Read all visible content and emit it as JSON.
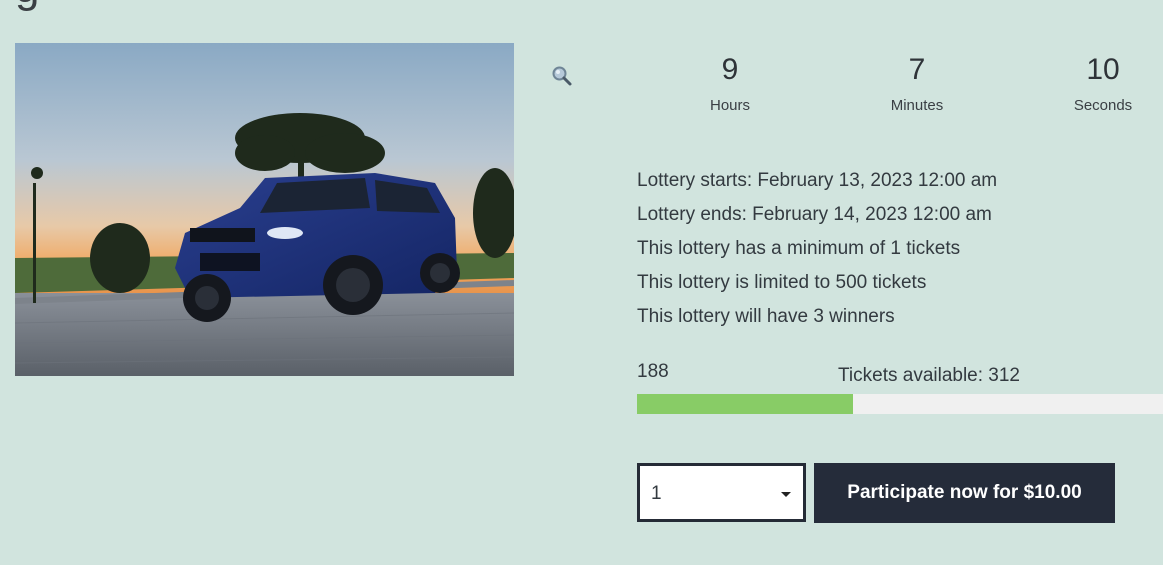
{
  "product": {
    "title_fragment": "g",
    "image": {
      "subject": "blue SUV parked on cobblestone at sunset",
      "icon": "product-photo"
    },
    "zoom_icon": "magnifier-icon"
  },
  "countdown": {
    "hours": {
      "value": "9",
      "label": "Hours"
    },
    "minutes": {
      "value": "7",
      "label": "Minutes"
    },
    "seconds": {
      "value": "10",
      "label": "Seconds"
    }
  },
  "lottery_info": [
    "Lottery starts: February 13, 2023 12:00 am",
    "Lottery ends: February 14, 2023 12:00 am",
    "This lottery has a minimum of 1 tickets",
    "This lottery is limited to 500 tickets",
    "This lottery will have 3 winners"
  ],
  "tickets": {
    "sold": "188",
    "available_text": "Tickets available: 312",
    "sold_fraction": 0.41,
    "bar_color": "#88cc66"
  },
  "purchase": {
    "quantity": "1",
    "button_label": "Participate now for $10.00",
    "button_color": "#252c3a"
  }
}
